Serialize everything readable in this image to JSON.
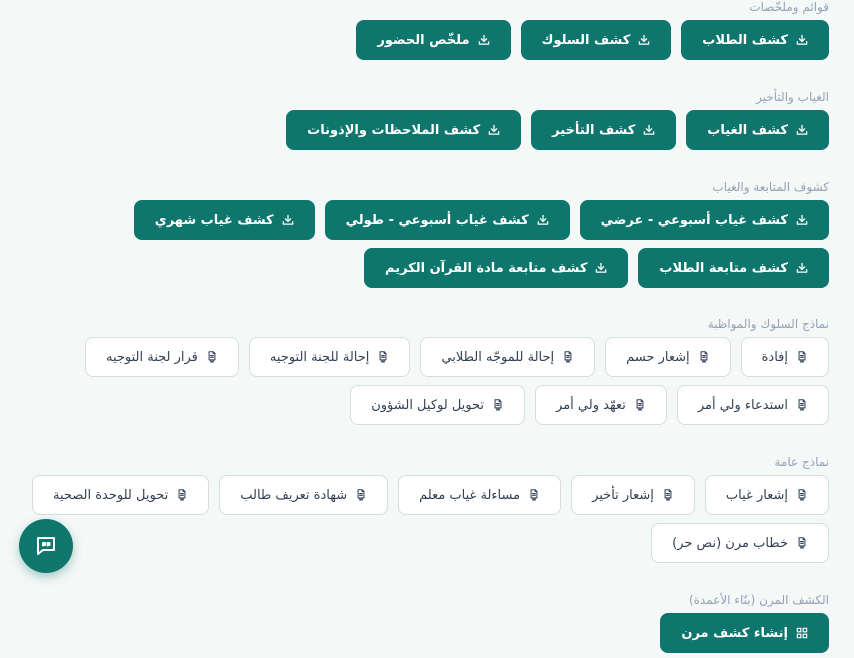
{
  "sections": [
    {
      "title": "قوائم وملخّصات",
      "style": "primary",
      "buttons": [
        {
          "label": "كشف الطلاب",
          "icon": "download-icon"
        },
        {
          "label": "كشف السلوك",
          "icon": "download-icon"
        },
        {
          "label": "ملخّص الحضور",
          "icon": "download-icon"
        }
      ]
    },
    {
      "title": "الغياب والتأخير",
      "style": "primary",
      "buttons": [
        {
          "label": "كشف الغياب",
          "icon": "download-icon"
        },
        {
          "label": "كشف التأخير",
          "icon": "download-icon"
        },
        {
          "label": "كشف الملاحظات والإذونات",
          "icon": "download-icon"
        }
      ]
    },
    {
      "title": "كشوف المتابعة والغياب",
      "style": "primary",
      "buttons": [
        {
          "label": "كشف غياب أسبوعي - عرضي",
          "icon": "download-icon"
        },
        {
          "label": "كشف غياب أسبوعي - طولي",
          "icon": "download-icon"
        },
        {
          "label": "كشف غياب شهري",
          "icon": "download-icon"
        },
        {
          "label": "كشف متابعة الطلاب",
          "icon": "download-icon"
        },
        {
          "label": "كشف متابعة مادة القرآن الكريم",
          "icon": "download-icon"
        }
      ]
    },
    {
      "title": "نماذج السلوك والمواظبة",
      "style": "outline",
      "buttons": [
        {
          "label": "إفادة",
          "icon": "document-icon"
        },
        {
          "label": "إشعار حسم",
          "icon": "document-icon"
        },
        {
          "label": "إحالة للموجّه الطلابي",
          "icon": "document-icon"
        },
        {
          "label": "إحالة للجنة التوجيه",
          "icon": "document-icon"
        },
        {
          "label": "قرار لجنة التوجيه",
          "icon": "document-icon"
        },
        {
          "label": "استدعاء ولي أمر",
          "icon": "document-icon"
        },
        {
          "label": "تعهّد ولي أمر",
          "icon": "document-icon"
        },
        {
          "label": "تحويل لوكيل الشؤون",
          "icon": "document-icon"
        }
      ]
    },
    {
      "title": "نماذج عامة",
      "style": "outline",
      "buttons": [
        {
          "label": "إشعار غياب",
          "icon": "document-icon"
        },
        {
          "label": "إشعار تأخير",
          "icon": "document-icon"
        },
        {
          "label": "مساءلة غياب معلم",
          "icon": "document-icon"
        },
        {
          "label": "شهادة تعريف طالب",
          "icon": "document-icon"
        },
        {
          "label": "تحويل للوحدة الصحية",
          "icon": "document-icon"
        },
        {
          "label": "خطاب مرن (نص حر)",
          "icon": "document-icon"
        }
      ]
    },
    {
      "title": "الكشف المرن (بنّاء الأعمدة)",
      "style": "primary",
      "buttons": [
        {
          "label": "إنشاء كشف مرن",
          "icon": "grid-icon"
        }
      ]
    }
  ],
  "fab": {
    "icon": "quote-chat-icon"
  },
  "colors": {
    "primary": "#0f766e",
    "background": "#f4f8f7",
    "title": "#94a3b8"
  }
}
